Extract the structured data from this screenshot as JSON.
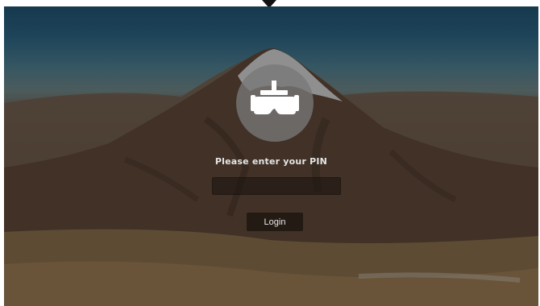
{
  "lock_screen": {
    "prompt": "Please enter your PIN",
    "pin_value": "",
    "pin_placeholder": "",
    "login_label": "Login",
    "avatar_icon": "vr-headset-icon"
  },
  "colors": {
    "overlay": "#00000047",
    "avatar_bg": "#787878",
    "button_bg": "#1c1410",
    "text": "#e6e6e6"
  }
}
